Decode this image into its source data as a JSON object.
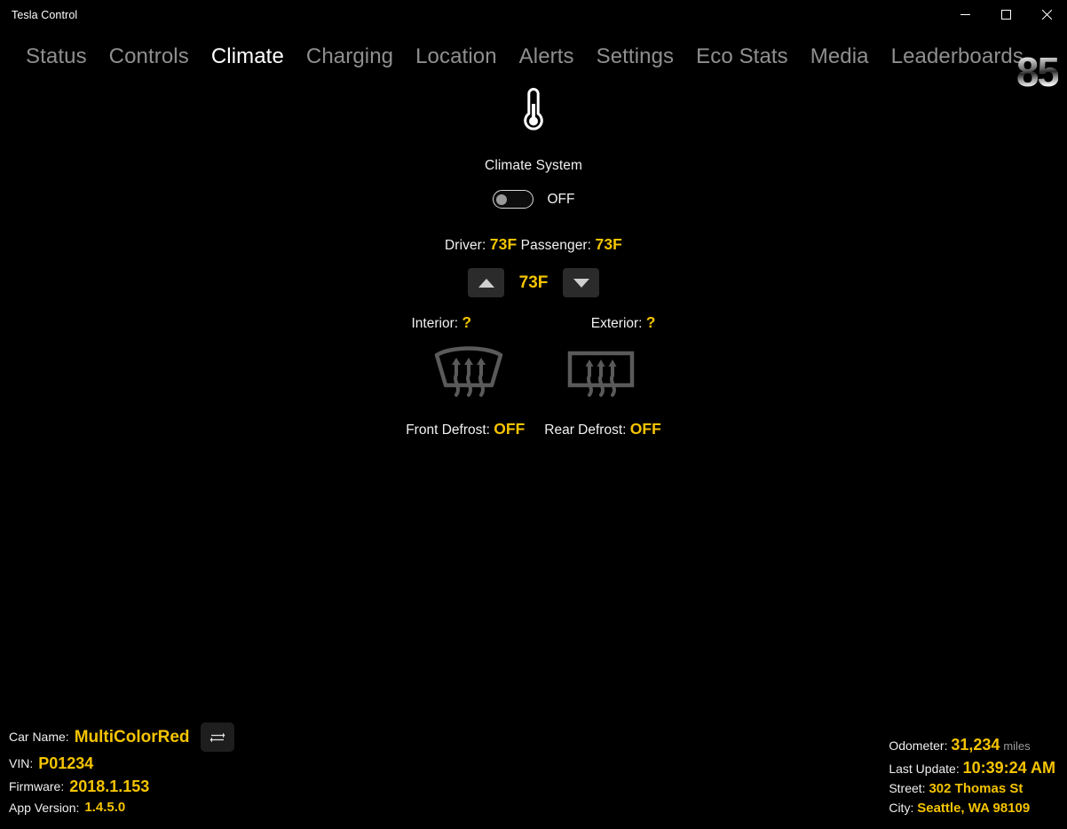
{
  "window": {
    "title": "Tesla Control",
    "minimize_label": "Minimize",
    "maximize_label": "Maximize",
    "close_label": "Close"
  },
  "nav": {
    "items": [
      {
        "label": "Status",
        "active": false
      },
      {
        "label": "Controls",
        "active": false
      },
      {
        "label": "Climate",
        "active": true
      },
      {
        "label": "Charging",
        "active": false
      },
      {
        "label": "Location",
        "active": false
      },
      {
        "label": "Alerts",
        "active": false
      },
      {
        "label": "Settings",
        "active": false
      },
      {
        "label": "Eco Stats",
        "active": false
      },
      {
        "label": "Media",
        "active": false
      },
      {
        "label": "Leaderboards",
        "active": false
      }
    ],
    "badge": "85"
  },
  "climate": {
    "icon": "thermometer-icon",
    "system_label": "Climate System",
    "system_state": "OFF",
    "system_on": false,
    "driver_label": "Driver:",
    "driver_temp": "73F",
    "passenger_label": "Passenger:",
    "passenger_temp": "73F",
    "set_temp": "73F",
    "increase_icon": "triangle-up-icon",
    "decrease_icon": "triangle-down-icon",
    "interior_label": "Interior:",
    "interior_temp": "?",
    "exterior_label": "Exterior:",
    "exterior_temp": "?",
    "front_defrost_label": "Front Defrost:",
    "front_defrost_state": "OFF",
    "rear_defrost_label": "Rear Defrost:",
    "rear_defrost_state": "OFF",
    "front_defrost_icon": "front-defrost-icon",
    "rear_defrost_icon": "rear-defrost-icon"
  },
  "footer_left": {
    "car_name_label": "Car Name:",
    "car_name_value": "MultiColorRed",
    "swap_icon": "swap-arrows-icon",
    "vin_label": "VIN:",
    "vin_value": "P01234",
    "firmware_label": "Firmware:",
    "firmware_value": "2018.1.153",
    "app_version_label": "App Version:",
    "app_version_value": "1.4.5.0"
  },
  "footer_right": {
    "odometer_label": "Odometer:",
    "odometer_value": "31,234",
    "odometer_unit": "miles",
    "last_update_label": "Last Update:",
    "last_update_value": "10:39:24 AM",
    "street_label": "Street:",
    "street_value": "302 Thomas St",
    "city_label": "City:",
    "city_value": "Seattle, WA 98109"
  },
  "colors": {
    "background": "#000000",
    "accent_amber": "#f5c400",
    "text_primary": "#ffffff",
    "text_muted": "#8f8f8f",
    "button_bg": "#2b2b2b"
  }
}
